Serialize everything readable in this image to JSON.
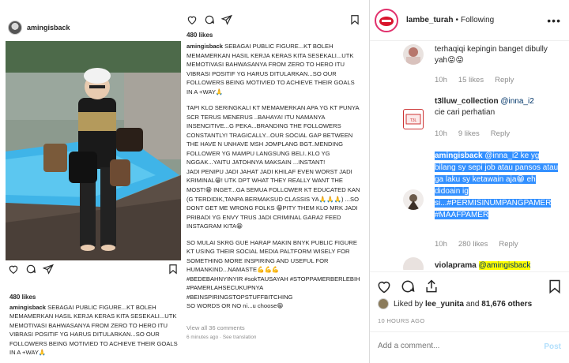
{
  "inner": {
    "username": "amingisback",
    "likes": "480 likes",
    "caption_user": "amingisback",
    "caption_left": "SEBAGAI PUBLIC FIGURE...KT BOLEH MEMAMERKAN HASIL KERJA KERAS KITA SESEKALI...UTK MEMOTIVASI BAHWASANYA FROM ZERO TO HERO ITU VIBRASI POSITIF YG HARUS DITULARKAN...SO OUR FOLLOWERS BEING MOTIVIED TO ACHIEVE THEIR GOALS IN A +WAY🙏",
    "caption_right_p1": "SEBAGAI PUBLIC FIGURE...KT BOLEH MEMAMERKAN HASIL KERJA KERAS KITA SESEKALI...UTK MEMOTIVASI BAHWASANYA FROM ZERO TO HERO ITU VIBRASI POSITIF YG HARUS DITULARKAN...SO OUR FOLLOWERS BEING MOTIVIED TO ACHIEVE THEIR GOALS IN A +WAY🙏",
    "caption_right_p2": "TAPI KLO SERINGKALI KT MEMAMERKAN APA YG KT PUNYA SCR TERUS MENERUS ..BAHAYA! ITU NAMANYA INSENCITIVE...G PEKA...BRANDING THE FOLLOWERS CONSTANTLY! TRAGICALLY...OUR SOCIAL GAP BETWEEN THE HAVE N UNHAVE MSH JOMPLANG BGT..MENDING FOLLOWER YG MAMPU LANGSUNG BELI..KLO YG NGGAK...YAITU JATOHNYA MAKSAIN ...INSTANT!",
    "caption_right_p3": "JADI PENIPU JADI JAHAT JADI KHILAF EVEN WORST JADI KRIMINAL😁! UTK DPT WHAT THEY REALLY WANT THE MOST!😁 INGET...GA SEMUA FOLLOWER KT EDUCATED KAN (G TERDIDIK,TANPA BERMAKSUD CLASSIS YA🙏🙏🙏) ...SO DONT GET ME WRONG FOLKS 😁PITY THEM KLO MRK JADI PRIBADI YG ENVY TRUS JADI CRIMINAL GARA2 FEED INSTAGRAM KITA😁",
    "caption_right_p4": "SO MULAI SKRG GUE  HARAP MAKIN BNYK  PUBLIC FIGURE KT USING THEIR SOCIAL MEDIA PALTFORM WISELY FOR SOMETHING MORE INSPIRING AND USEFUL FOR HUMANKIND...NAMASTE💪💪💪",
    "hashtags": "#BEDEBAHNYINYIR #sokTAUSAYAH #STOPPAMERBERLEBIH #PAMERLAHSECUKUPNYA #BEINSPIRINGSTOPSTUFFBITCHING",
    "caption_tail": "SO WORDS OR NO ni...u choose😁",
    "view_all": "View all 36 comments",
    "time_line": "6 minutes ago · See translation"
  },
  "panel": {
    "username": "lambe_turah",
    "dot": "•",
    "following": "Following",
    "more": "•••",
    "comments": [
      {
        "text": "terhaqiqi kepingin banget dibully yah😝😝",
        "time": "10h",
        "likes": "15 likes",
        "reply": "Reply"
      },
      {
        "user": "t3lluw_collection",
        "mention": "@inna_i2",
        "text": "cie cari perhatian",
        "time": "10h",
        "likes": "9 likes",
        "reply": "Reply"
      },
      {
        "user": "amingisback",
        "mention": "@inna_i2",
        "text": "ke yg bilang sy sepi job atau pansos atau ga laku sy ketawain aja😁 eh didoain ig si...#PERMISINUMPANGPAMER #MAAFPAMER",
        "time": "10h",
        "likes": "280 likes",
        "reply": "Reply"
      },
      {
        "user": "violaprama",
        "mention": "@amingisback"
      }
    ],
    "liked_by_prefix": "Liked by",
    "liked_by_user": "lee_yunita",
    "liked_by_and": "and",
    "liked_by_count": "81,676 others",
    "timestamp": "10 HOURS AGO",
    "add_comment_placeholder": "Add a comment...",
    "post_label": "Post"
  },
  "colors": {
    "accent_link": "#003569",
    "selection": "#3390ff",
    "highlight": "#ffff00",
    "muted": "#8e8e8e",
    "post_disabled": "#b2dffc"
  },
  "icons": [
    "heart-icon",
    "comment-icon",
    "share-icon",
    "bookmark-icon",
    "more-icon"
  ]
}
